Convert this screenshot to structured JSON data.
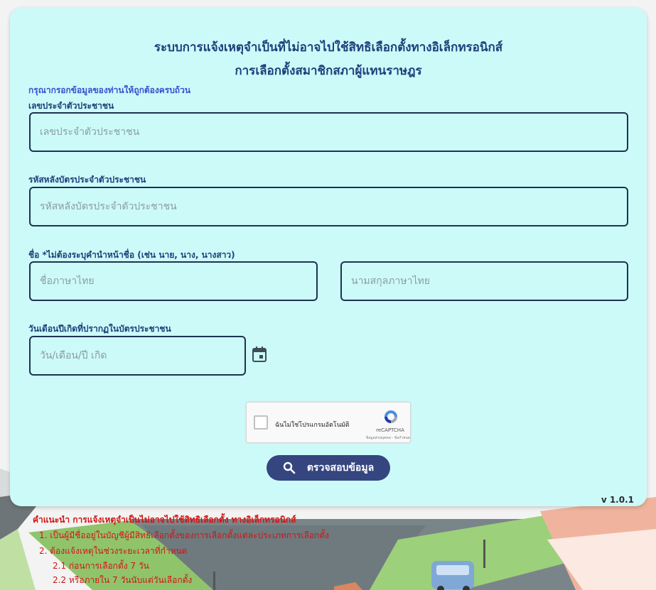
{
  "form": {
    "title_line1": "ระบบการแจ้งเหตุจำเป็นที่ไม่อาจไปใช้สิทธิเลือกตั้งทางอิเล็กทรอนิกส์",
    "title_line2": "การเลือกตั้งสมาชิกสภาผู้แทนราษฎร",
    "instruction": "กรุณากรอกข้อมูลของท่านให้ถูกต้องครบถ้วน",
    "id_label": "เลขประจำตัวประชาชน",
    "id_placeholder": "เลขประจำตัวประชาชน",
    "laser_label": "รหัสหลังบัตรประจำตัวประชาชน",
    "laser_placeholder": "รหัสหลังบัตรประจำตัวประชาชน",
    "name_label": "ชื่อ *ไม่ต้องระบุคำนำหน้าชื่อ (เช่น นาย, นาง, นางสาว)",
    "firstname_placeholder": "ชื่อภาษาไทย",
    "lastname_placeholder": "นามสกุลภาษาไทย",
    "dob_label": "วันเดือนปีเกิดที่ปรากฏในบัตรประชาชน",
    "dob_placeholder": "วัน/เดือน/ปี เกิด",
    "submit_label": "ตรวจสอบข้อมูล",
    "version": "v 1.0.1"
  },
  "captcha": {
    "label": "ฉันไม่ใช่โปรแกรมอัตโนมัติ",
    "brand": "reCAPTCHA",
    "links": "ข้อมูลส่วนบุคคล - ข้อกำหนด"
  },
  "notes": {
    "heading": "คำแนะนำ การแจ้งเหตุจำเป็นไม่อาจไปใช้สิทธิเลือกตั้ง ทางอิเล็กทรอนิกส์",
    "item1": "1. เป็นผู้มีชื่ออยู่ในบัญชีผู้มีสิทธิเลือกตั้งของการเลือกตั้งแต่ละประเภทการเลือกตั้ง",
    "item2": "2. ต้องแจ้งเหตุในช่วงระยะเวลาที่กำหนด",
    "item2_1": "2.1 ก่อนการเลือกตั้ง 7 วัน",
    "item2_2": "2.2 หรือภายใน 7 วันนับแต่วันเลือกตั้ง"
  },
  "icons": {
    "calendar": "calendar-icon",
    "search": "search-icon",
    "recaptcha": "recaptcha-logo-icon"
  },
  "colors": {
    "card": "#ccfaf9",
    "title": "#1f3f7a",
    "button": "#35457f",
    "notes": "#d21414"
  }
}
